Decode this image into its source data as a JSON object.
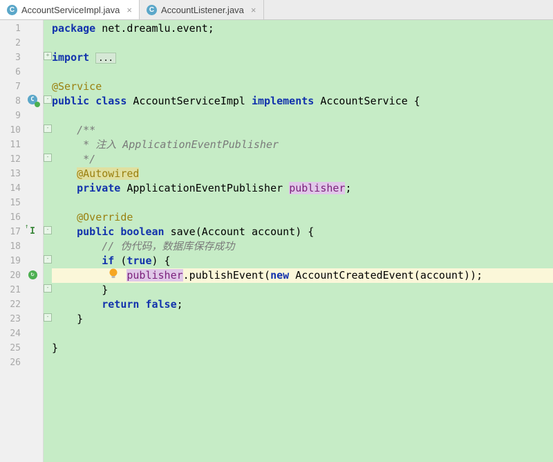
{
  "tabs": [
    {
      "icon": "C",
      "label": "AccountServiceImpl.java",
      "active": true
    },
    {
      "icon": "C",
      "label": "AccountListener.java",
      "active": false
    }
  ],
  "gutter": [
    "1",
    "2",
    "3",
    "6",
    "7",
    "8",
    "9",
    "10",
    "11",
    "12",
    "13",
    "14",
    "15",
    "16",
    "17",
    "18",
    "19",
    "20",
    "21",
    "22",
    "23",
    "24",
    "25",
    "26"
  ],
  "code": {
    "l1a": "package",
    "l1b": " net.dreamlu.event;",
    "l3a": "import",
    "l3b": " ",
    "l3fold": "...",
    "l7": "@Service",
    "l8a": "public",
    "l8b": " ",
    "l8c": "class",
    "l8d": " AccountServiceImpl ",
    "l8e": "implements",
    "l8f": " AccountService {",
    "l10a": "/**",
    "l11a": " * 注入 ",
    "l11b": "ApplicationEventPublisher",
    "l12a": " */",
    "l13": "@Autowired",
    "l14a": "private",
    "l14b": " ApplicationEventPublisher ",
    "l14c": "publisher",
    "l14d": ";",
    "l16": "@Override",
    "l17a": "public",
    "l17b": " ",
    "l17c": "boolean",
    "l17d": " save(Account account) {",
    "l18": "// 伪代码，数据库保存成功",
    "l19a": "if",
    "l19b": " (",
    "l19c": "true",
    "l19d": ") {",
    "l20a": "publisher",
    "l20b": ".publishEvent(",
    "l20c": "new",
    "l20d": " AccountCreatedEvent(account));",
    "l21": "}",
    "l22a": "return",
    "l22b": " ",
    "l22c": "false",
    "l22d": ";",
    "l23": "}",
    "l25": "}"
  }
}
